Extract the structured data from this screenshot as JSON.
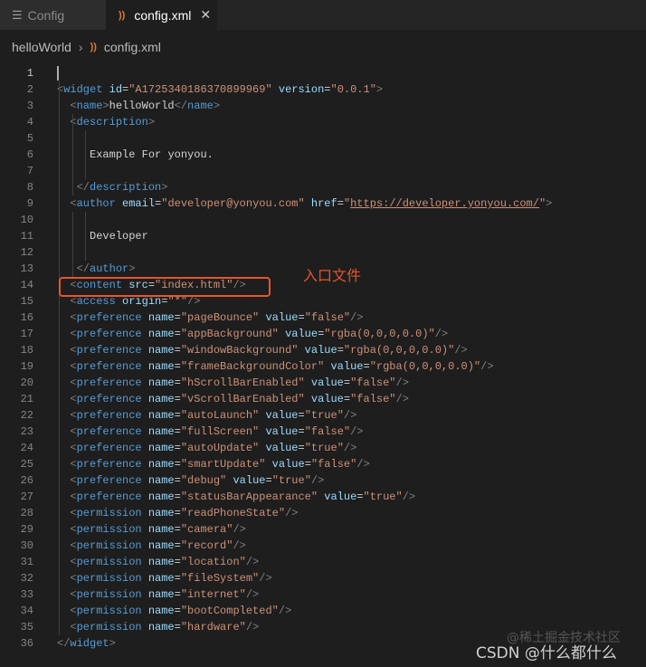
{
  "tabs": [
    {
      "label": "Config",
      "icon": "list-icon",
      "active": false
    },
    {
      "label": "config.xml",
      "icon": "rss-icon",
      "active": true
    }
  ],
  "breadcrumb": {
    "folder": "helloWorld",
    "file": "config.xml"
  },
  "colors": {
    "tag": "#569cd6",
    "attr": "#9cdcfe",
    "string": "#ce9178",
    "punct": "#808080",
    "highlight": "#e8542c"
  },
  "annotation": "入口文件",
  "watermark": {
    "juejin": "@稀土掘金技术社区",
    "csdn": "CSDN @什么都什么"
  },
  "code_lines": [
    "",
    "<widget id=\"A1725340186370899969\" version=\"0.0.1\">",
    "  <name>helloWorld</name>",
    "  <description>",
    "",
    "     Example For yonyou.",
    "",
    "   </description>",
    "  <author email=\"developer@yonyou.com\" href=\"https://developer.yonyou.com/\">",
    "",
    "     Developer",
    "",
    "   </author>",
    "  <content src=\"index.html\"/>",
    "  <access origin=\"*\"/>",
    "  <preference name=\"pageBounce\" value=\"false\"/>",
    "  <preference name=\"appBackground\" value=\"rgba(0,0,0,0.0)\"/>",
    "  <preference name=\"windowBackground\" value=\"rgba(0,0,0,0.0)\"/>",
    "  <preference name=\"frameBackgroundColor\" value=\"rgba(0,0,0,0.0)\"/>",
    "  <preference name=\"hScrollBarEnabled\" value=\"false\"/>",
    "  <preference name=\"vScrollBarEnabled\" value=\"false\"/>",
    "  <preference name=\"autoLaunch\" value=\"true\"/>",
    "  <preference name=\"fullScreen\" value=\"false\"/>",
    "  <preference name=\"autoUpdate\" value=\"true\"/>",
    "  <preference name=\"smartUpdate\" value=\"false\"/>",
    "  <preference name=\"debug\" value=\"true\"/>",
    "  <preference name=\"statusBarAppearance\" value=\"true\"/>",
    "  <permission name=\"readPhoneState\"/>",
    "  <permission name=\"camera\"/>",
    "  <permission name=\"record\"/>",
    "  <permission name=\"location\"/>",
    "  <permission name=\"fileSystem\"/>",
    "  <permission name=\"internet\"/>",
    "  <permission name=\"bootCompleted\"/>",
    "  <permission name=\"hardware\"/>",
    "</widget>"
  ]
}
